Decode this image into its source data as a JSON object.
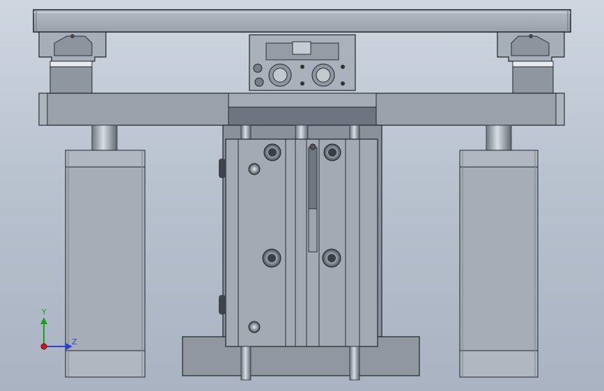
{
  "view": {
    "background_top": "#cfd6e0",
    "background_bottom": "#a9b3c1"
  },
  "triad": {
    "y_label": "Y",
    "z_label": "Z",
    "y_color": "#1f9d1f",
    "z_color": "#2b3fd6",
    "origin_color": "#d01818"
  }
}
